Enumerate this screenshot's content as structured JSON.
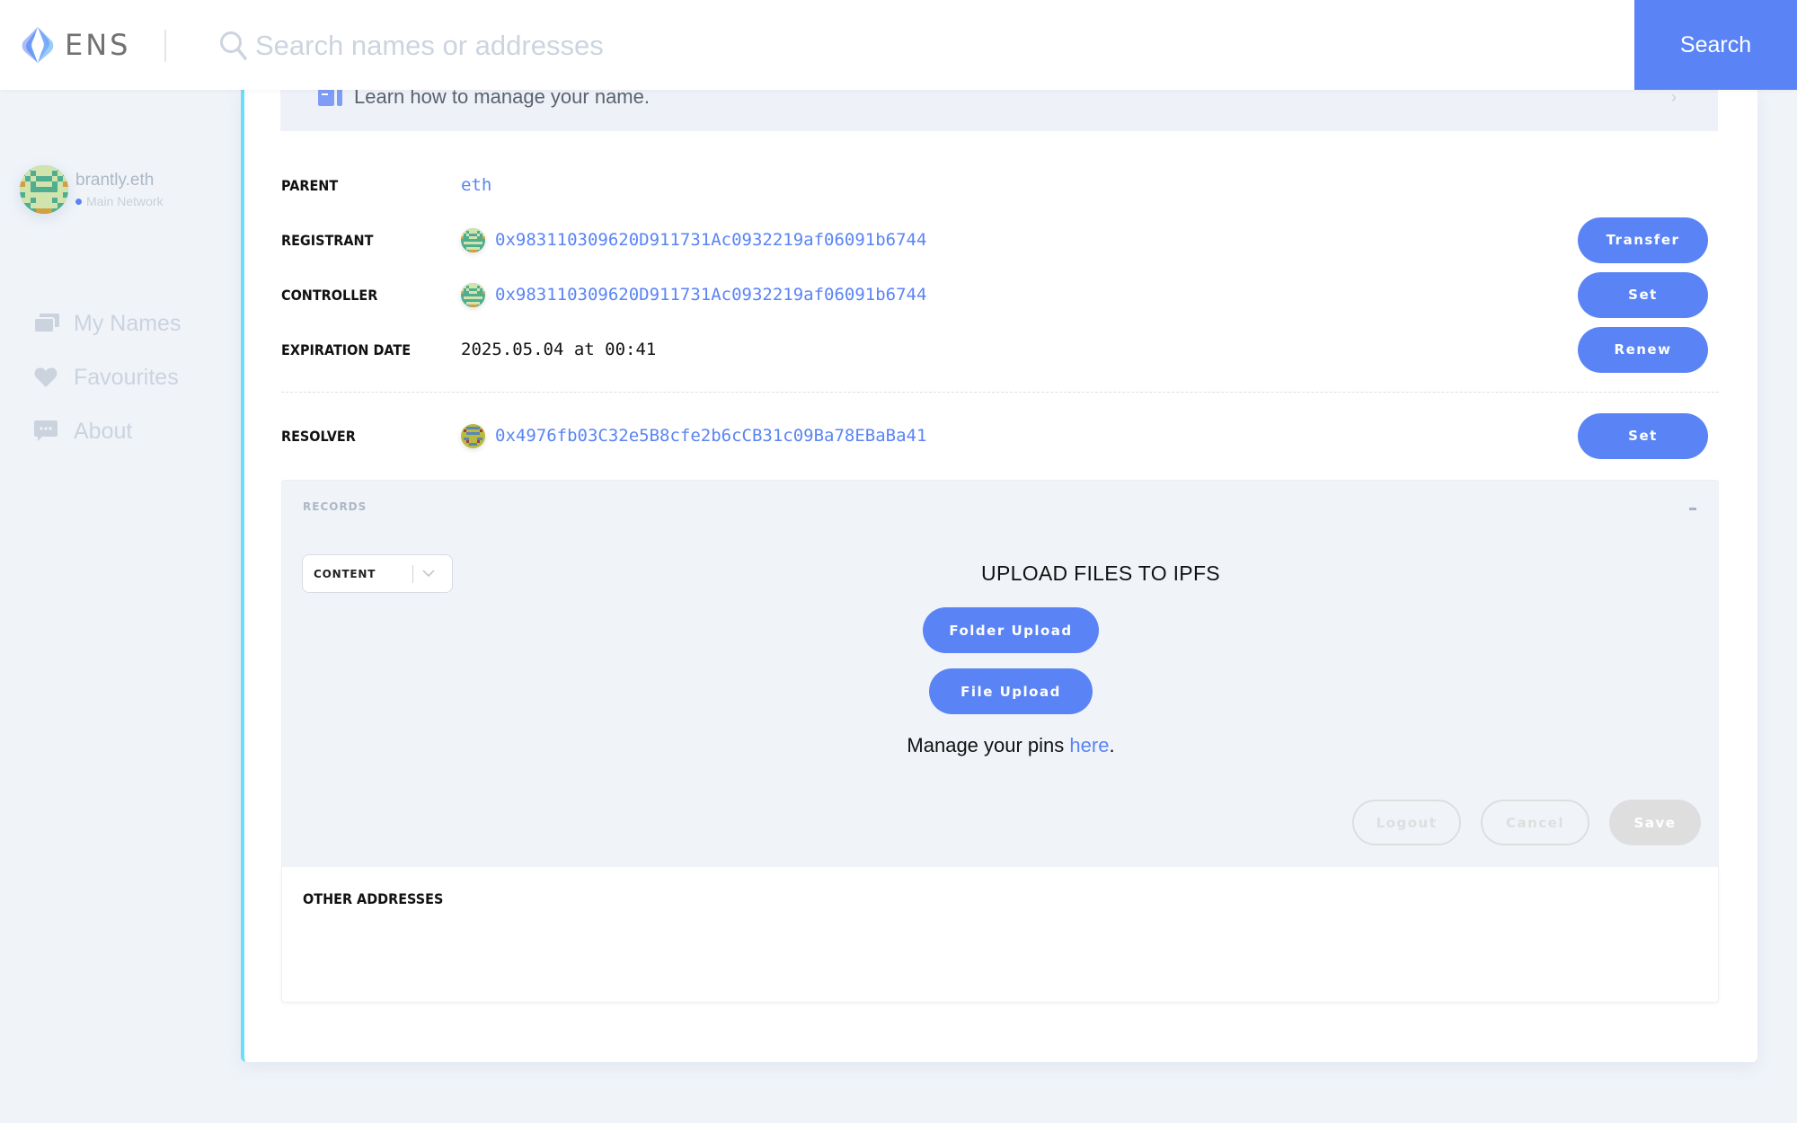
{
  "header": {
    "logo_text": "ENS",
    "search_placeholder": "Search names or addresses",
    "search_value": "",
    "search_button": "Search"
  },
  "sidebar": {
    "account": {
      "name": "brantly.eth",
      "network": "Main Network"
    },
    "items": [
      {
        "label": "My Names",
        "icon": "names-stack-icon"
      },
      {
        "label": "Favourites",
        "icon": "heart-icon"
      },
      {
        "label": "About",
        "icon": "chat-bubble-icon"
      }
    ]
  },
  "main": {
    "learn_banner": "Learn how to manage your name.",
    "details": {
      "parent": {
        "label": "PARENT",
        "value": "eth"
      },
      "registrant": {
        "label": "REGISTRANT",
        "value": "0x983110309620D911731Ac0932219af06091b6744",
        "action": "Transfer"
      },
      "controller": {
        "label": "CONTROLLER",
        "value": "0x983110309620D911731Ac0932219af06091b6744",
        "action": "Set"
      },
      "expiration": {
        "label": "EXPIRATION DATE",
        "value": "2025.05.04 at 00:41",
        "action": "Renew"
      },
      "resolver": {
        "label": "RESOLVER",
        "value": "0x4976fb03C32e5B8cfe2b6cCB31c09Ba78EBaBa41",
        "action": "Set"
      }
    },
    "records": {
      "title": "RECORDS",
      "collapse_symbol": "-",
      "selected_type": "CONTENT",
      "upload_title": "UPLOAD FILES TO IPFS",
      "folder_upload": "Folder Upload",
      "file_upload": "File Upload",
      "pins_prefix": "Manage your pins ",
      "pins_link": "here",
      "pins_suffix": ".",
      "logout": "Logout",
      "cancel": "Cancel",
      "save": "Save"
    },
    "other_addresses": {
      "title": "OTHER ADDRESSES"
    }
  },
  "colors": {
    "accent": "#5a84f5",
    "card_border": "#6ddcf8",
    "background": "#f0f4f9",
    "disabled": "#dedede"
  }
}
